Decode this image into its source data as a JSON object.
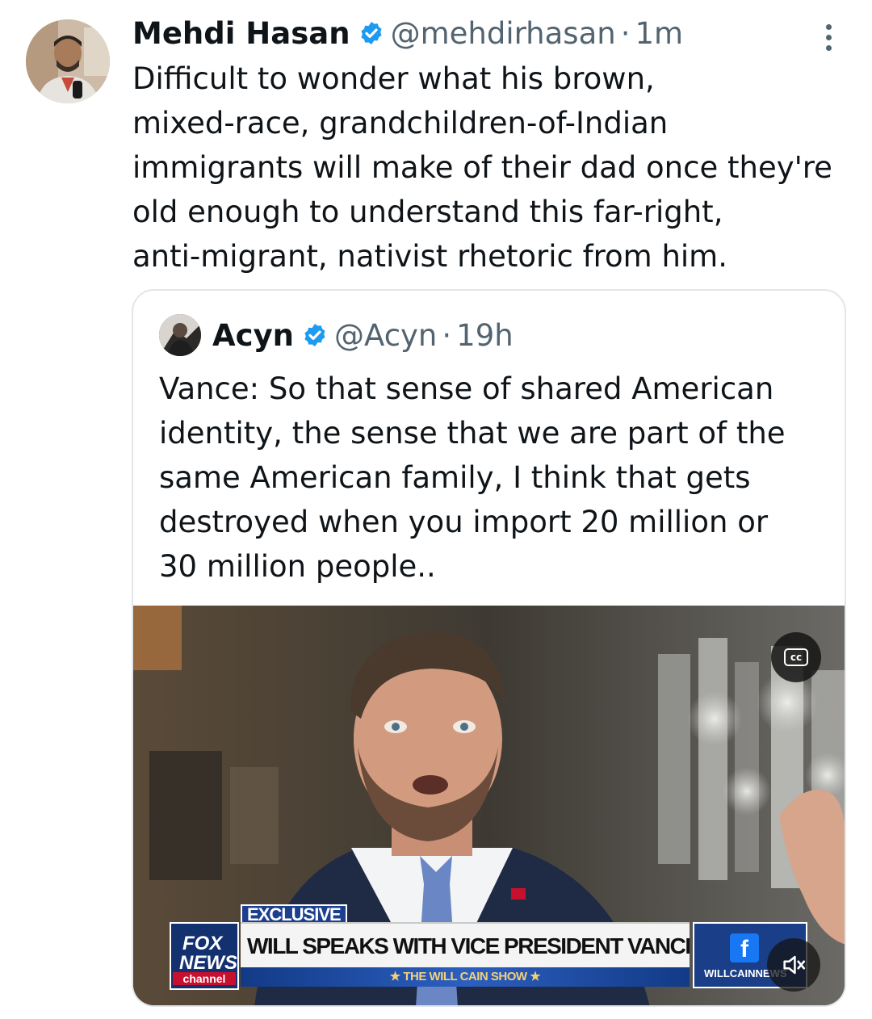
{
  "tweet": {
    "author_name": "Mehdi Hasan",
    "handle": "@mehdirhasan",
    "separator": "·",
    "time": "1m",
    "text_lines": [
      "Difficult to wonder what his brown,",
      "mixed-race, grandchildren-of-Indian",
      "immigrants will make of their dad once they're",
      "old enough to understand this far-right,",
      "anti-migrant, nativist rhetoric from him."
    ]
  },
  "quote": {
    "author_name": "Acyn",
    "handle": "@Acyn",
    "separator": "·",
    "time": "19h",
    "text_lines": [
      "Vance: So that sense of shared American",
      "identity, the sense that we are part of the",
      "same American family, I think that gets",
      "destroyed when you import 20 million or",
      "30 million people.."
    ]
  },
  "video": {
    "cc_label": "cc",
    "exclusive_tag": "EXCLUSIVE",
    "network_logo_line1": "FOX",
    "network_logo_line2": "NEWS",
    "network_logo_line3": "channel",
    "headline": "WILL SPEAKS WITH VICE PRESIDENT VANCE IN WISCONSIN",
    "show_name": "★ THE WILL CAIN SHOW ★",
    "social_handle": "WILLCAINNEWS",
    "facebook_glyph": "f"
  },
  "colors": {
    "verified_blue": "#1d9bf0",
    "text_primary": "#0f1419",
    "text_secondary": "#536471",
    "fox_navy": "#13306f",
    "fox_red": "#c8102e"
  },
  "icons": {
    "verified": "verified-badge-icon",
    "more": "more-vertical-icon",
    "cc": "closed-captions-icon",
    "mute": "speaker-muted-icon",
    "facebook": "facebook-icon"
  }
}
